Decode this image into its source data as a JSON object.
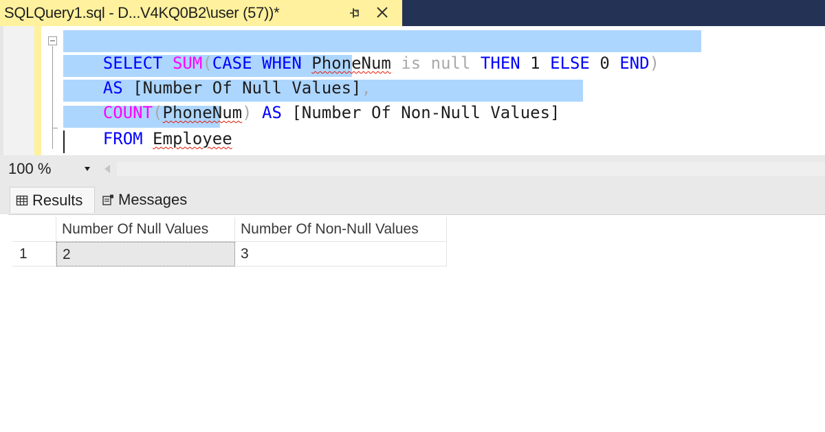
{
  "tab": {
    "title": "SQLQuery1.sql - D...V4KQ0B2\\user (57))*",
    "pin_icon": "pin-icon",
    "close_icon": "close-icon"
  },
  "editor": {
    "line1": {
      "t1": "SELECT",
      "t2": " ",
      "t3": "SUM",
      "t4": "(",
      "t5": "CASE",
      "t6": " ",
      "t7": "WHEN",
      "t8": " ",
      "t9": "PhoneNum",
      "t10": " ",
      "t11": "is null",
      "t12": " ",
      "t13": "THEN",
      "t14": " 1 ",
      "t15": "ELSE",
      "t16": " 0 ",
      "t17": "END",
      "t18": ")"
    },
    "line2": {
      "t1": "AS",
      "t2": " [Number Of Null Values]",
      "t3": ","
    },
    "line3": {
      "t1": "COUNT",
      "t2": "(",
      "t3": "PhoneNum",
      "t4": ")",
      "t5": " ",
      "t6": "AS",
      "t7": " [Number Of Non-Null Values]"
    },
    "line4": {
      "t1": "FROM",
      "t2": " ",
      "t3": "Employee"
    }
  },
  "zoom": {
    "value": "100 %"
  },
  "result_tabs": {
    "results_label": "Results",
    "messages_label": "Messages"
  },
  "grid": {
    "columns": [
      "Number Of Null Values",
      "Number Of Non-Null Values"
    ],
    "rows": [
      {
        "num": "1",
        "cells": [
          "2",
          "3"
        ]
      }
    ]
  },
  "colors": {
    "tab_active": "#fff19d",
    "titlebar": "#243355",
    "keyword": "#0000ff",
    "function": "#ff00ff",
    "selection": "#add6ff"
  }
}
